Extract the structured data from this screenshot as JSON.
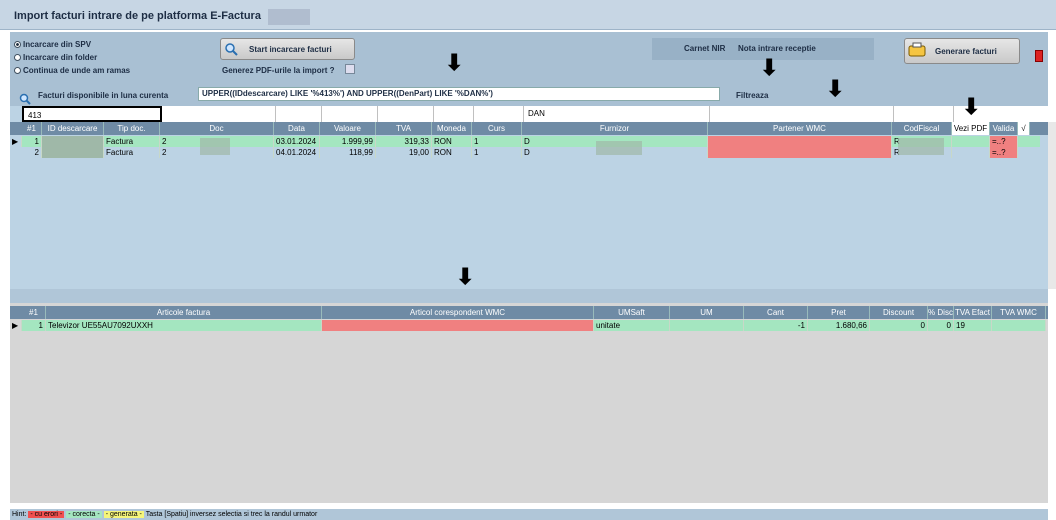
{
  "window": {
    "title": "Import facturi intrare de pe platforma E-Factura"
  },
  "source_options": [
    {
      "label": "Incarcare din SPV",
      "selected": true
    },
    {
      "label": "Incarcare din folder",
      "selected": false
    },
    {
      "label": "Continua de unde am ramas",
      "selected": false
    }
  ],
  "start_button": "Start incarcare facturi",
  "generate_pdf_label": "Generez PDF-urile la import ?",
  "carnet_label": "Carnet NIR",
  "carnet_value": "Nota intrare receptie",
  "generate_button": "Generare facturi",
  "filter": {
    "title": "Facturi disponibile in luna curenta",
    "expression": "UPPER((IDdescarcare) LIKE '%413%') AND UPPER((DenPart) LIKE '%DAN%')",
    "button": "Filtreaza",
    "id_value": "413",
    "furnizor_value": "DAN"
  },
  "invoices": {
    "headers": [
      "#1",
      "ID descarcare",
      "Tip doc.",
      "Doc",
      "Data",
      "Valoare",
      "TVA",
      "Moneda",
      "Curs",
      "Furnizor",
      "Partener WMC",
      "CodFiscal",
      "Vezi PDF",
      "Valida",
      "√"
    ],
    "rows": [
      {
        "num": "1",
        "tip": "Factura",
        "doc": "2",
        "data": "03.01.2024",
        "valoare": "1.999,99",
        "tva": "319,33",
        "moneda": "RON",
        "curs": "1",
        "furnizor": "D",
        "cod": "R",
        "valida": "=..?"
      },
      {
        "num": "2",
        "tip": "Factura",
        "doc": "2",
        "data": "04.01.2024",
        "valoare": "118,99",
        "tva": "19,00",
        "moneda": "RON",
        "curs": "1",
        "furnizor": "D",
        "cod": "R",
        "valida": "=..?"
      }
    ]
  },
  "articles": {
    "headers": [
      "#1",
      "Articole factura",
      "Articol corespondent WMC",
      "UMSaft",
      "UM",
      "Cant",
      "Pret",
      "Discount",
      "% Disc",
      "TVA Efact",
      "TVA WMC"
    ],
    "rows": [
      {
        "num": "1",
        "name": "Televizor UE55AU7092UXXH",
        "umsaft": "unitate",
        "cant": "-1",
        "pret": "1.680,66",
        "discount": "0",
        "disc": "0",
        "tva": "19"
      }
    ]
  },
  "hint": {
    "prefix": "Hint:",
    "erori": "- cu erori -",
    "corecta": "- corecta -",
    "generata": "- generata -",
    "text": "Tasta [Spatiu] inversez selectia si trec la randul urmator"
  },
  "colors": {
    "error": "#f08080",
    "correct": "#a4e6c0",
    "generated": "#f5f57a",
    "header": "#6f8ba5"
  }
}
